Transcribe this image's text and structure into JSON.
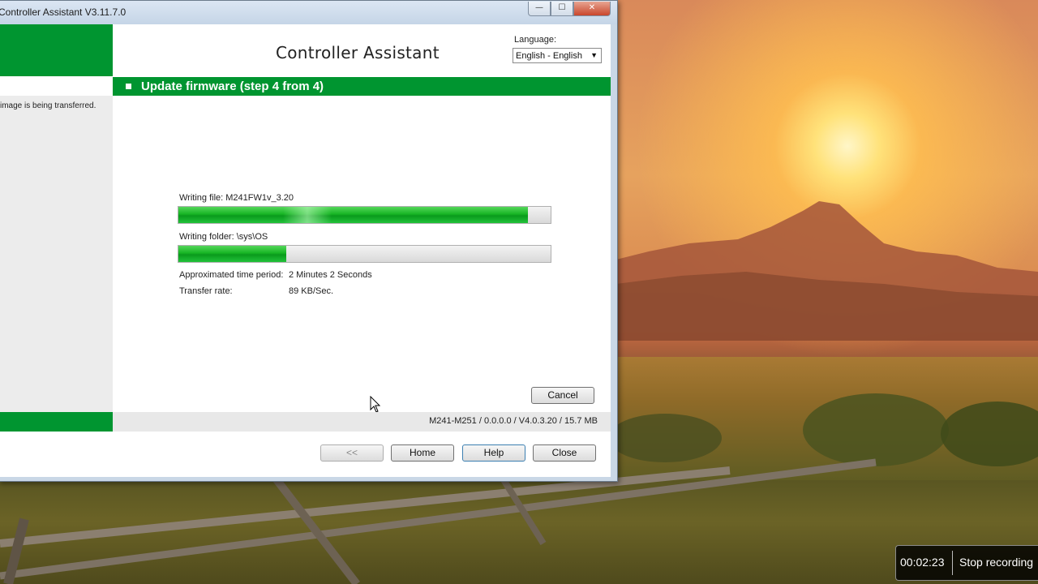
{
  "window": {
    "title": "Controller Assistant V3.11.7.0",
    "controls": {
      "minimize": "—",
      "maximize": "☐",
      "close": "✕"
    }
  },
  "header": {
    "app_title": "Controller Assistant",
    "language_label": "Language:",
    "language_value": "English - English"
  },
  "sidebar": {
    "info_text": "image is being transferred."
  },
  "step": {
    "title": "Update firmware (step 4 from 4)"
  },
  "transfer": {
    "file_label": "Writing file: M241FW1v_3.20",
    "file_progress": 0.94,
    "folder_label": "Writing folder: \\sys\\OS",
    "folder_progress": 0.29,
    "time_label": "Approximated time period:",
    "time_value": "2 Minutes 2 Seconds",
    "rate_label": "Transfer rate:",
    "rate_value": "89 KB/Sec."
  },
  "buttons": {
    "cancel": "Cancel",
    "back": "<<",
    "home": "Home",
    "help": "Help",
    "close": "Close"
  },
  "status": {
    "device_info": "M241-M251 / 0.0.0.0 / V4.0.3.20 / 15.7 MB"
  },
  "recorder": {
    "elapsed": "00:02:23",
    "stop_label": "Stop recording"
  },
  "colors": {
    "brand_green": "#009530",
    "progress_green": "#17b524"
  },
  "icons": [
    "mouse-pointer-icon",
    "dropdown-arrow-icon"
  ]
}
